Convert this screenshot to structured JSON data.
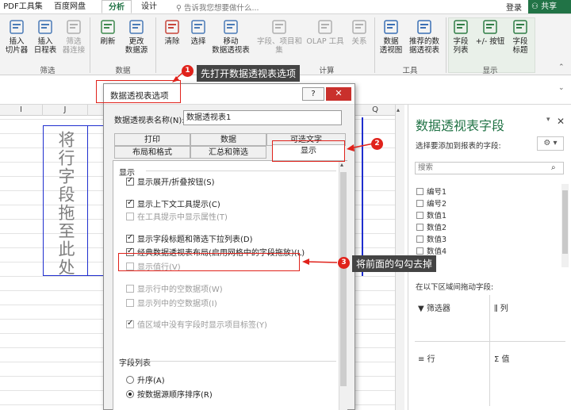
{
  "tabs": [
    "PDF工具集",
    "百度网盘",
    "分析",
    "设计"
  ],
  "active_tab": "分析",
  "tell_me": "告诉我您想要做什么...",
  "login": "登录",
  "share": "共享",
  "ribbon": {
    "buttons": [
      {
        "label": "插入\n切片器",
        "icon": "insert-slicer-icon",
        "dim": false
      },
      {
        "label": "插入\n日程表",
        "icon": "insert-timeline-icon",
        "dim": false
      },
      {
        "label": "筛选\n器连接",
        "icon": "filter-connections-icon",
        "dim": true
      },
      {
        "label": "刷新",
        "icon": "refresh-icon",
        "dim": false
      },
      {
        "label": "更改\n数据源",
        "icon": "change-source-icon",
        "dim": false
      },
      {
        "label": "清除",
        "icon": "clear-icon",
        "dim": false
      },
      {
        "label": "选择",
        "icon": "select-icon",
        "dim": false
      },
      {
        "label": "移动\n数据透视表",
        "icon": "move-pivot-icon",
        "dim": false
      },
      {
        "label": "字段、项目和\n集",
        "icon": "fields-items-icon",
        "dim": true
      },
      {
        "label": "OLAP 工具",
        "icon": "olap-icon",
        "dim": true
      },
      {
        "label": "关系",
        "icon": "relationships-icon",
        "dim": true
      },
      {
        "label": "数据\n透视图",
        "icon": "pivot-chart-icon",
        "dim": false
      },
      {
        "label": "推荐的数\n据透视表",
        "icon": "recommended-pivot-icon",
        "dim": false
      },
      {
        "label": "字段\n列表",
        "icon": "field-list-icon",
        "dim": false
      },
      {
        "label": "+/- 按钮",
        "icon": "plus-minus-icon",
        "dim": false
      },
      {
        "label": "字段\n标题",
        "icon": "field-headers-icon",
        "dim": false
      }
    ],
    "groups": [
      "筛选",
      "数据",
      "计算",
      "工具",
      "显示"
    ]
  },
  "columns": [
    "I",
    "J",
    "Q"
  ],
  "sheet_text": "将行字段拖至此处",
  "dialog": {
    "title": "数据透视表选项",
    "help": "?",
    "close": "✕",
    "name_label": "数据透视表名称(N):",
    "name_value": "数据透视表1",
    "tabs_row1": [
      "打印",
      "数据",
      "可选文字"
    ],
    "tabs_row2": [
      "布局和格式",
      "汇总和筛选",
      "显示"
    ],
    "active_tab": "显示",
    "section_display": "显示",
    "checks": [
      {
        "label": "显示展开/折叠按钮(S)",
        "checked": true,
        "disabled": false
      },
      {
        "label": "显示上下文工具提示(C)",
        "checked": true,
        "disabled": false
      },
      {
        "label": "在工具提示中显示属性(T)",
        "checked": false,
        "disabled": true
      },
      {
        "label": "显示字段标题和筛选下拉列表(D)",
        "checked": true,
        "disabled": false
      },
      {
        "label": "经典数据透视表布局(启用网格中的字段拖放)(L)",
        "checked": true,
        "disabled": false
      },
      {
        "label": "显示值行(V)",
        "checked": false,
        "disabled": true
      },
      {
        "label": "显示行中的空数据项(W)",
        "checked": false,
        "disabled": true
      },
      {
        "label": "显示列中的空数据项(I)",
        "checked": false,
        "disabled": true
      },
      {
        "label": "值区域中没有字段时显示项目标签(Y)",
        "checked": true,
        "disabled": true
      }
    ],
    "section_fieldlist": "字段列表",
    "radios": [
      {
        "label": "升序(A)",
        "selected": false
      },
      {
        "label": "按数据源顺序排序(R)",
        "selected": true
      }
    ]
  },
  "annotations": [
    {
      "num": "1",
      "text": "先打开数据透视表选项"
    },
    {
      "num": "2",
      "text": ""
    },
    {
      "num": "3",
      "text": "将前面的勾勾去掉"
    }
  ],
  "pane": {
    "title": "数据透视表字段",
    "subtitle": "选择要添加到报表的字段:",
    "search": "搜索",
    "fields": [
      "编号1",
      "编号2",
      "数值1",
      "数值2",
      "数值3",
      "数值4"
    ],
    "hint": "在以下区域间拖动字段:",
    "areas": {
      "filter": "筛选器",
      "columns": "列",
      "rows": "行",
      "values": "值"
    }
  },
  "colors": {
    "accent": "#217346",
    "annotation": "#e0221b",
    "border_blue": "#1f2ecf"
  }
}
